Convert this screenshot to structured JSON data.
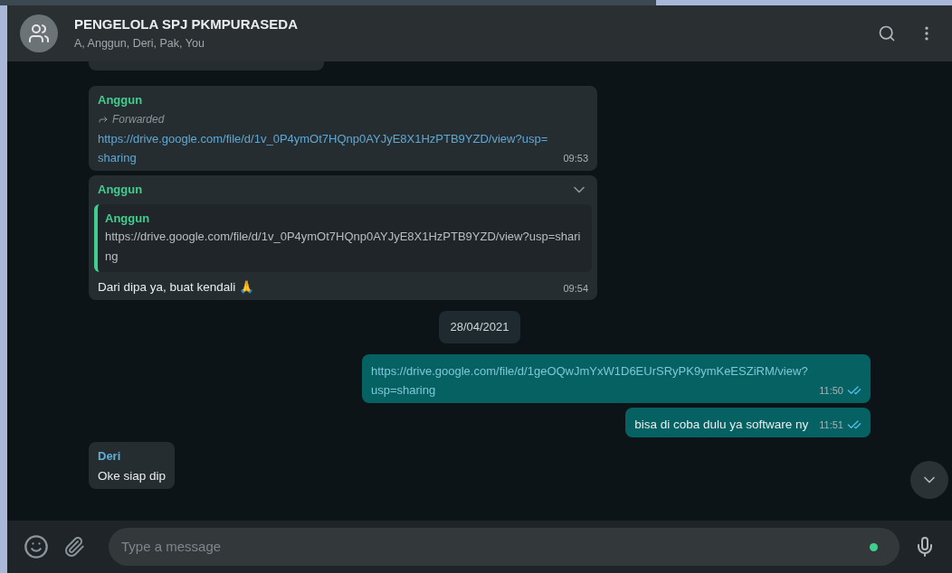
{
  "header": {
    "title": "PENGELOLA SPJ PKMPURASEDA",
    "participants": "A, Anggun, Deri, Pak, You"
  },
  "messages": [
    {
      "kind": "forwarded",
      "outgoing": false,
      "sender": "Anggun",
      "color": "#3fcf8e",
      "forwarded_label": "Forwarded",
      "text": "https://drive.google.com/file/d/1v_0P4ymOt7HQnp0AYJyE8X1HzPTB9YZD/view?usp=sharing",
      "link": true,
      "time": "09:53"
    },
    {
      "kind": "reply",
      "outgoing": false,
      "sender": "Anggun",
      "color": "#3fcf8e",
      "quote_sender": "Anggun",
      "quote_text": "https://drive.google.com/file/d/1v_0P4ymOt7HQnp0AYJyE8X1HzPTB9YZD/view?usp=sharing",
      "text": "Dari dipa ya, buat kendali 🙏",
      "link": false,
      "time": "09:54"
    },
    {
      "kind": "date",
      "text": "28/04/2021"
    },
    {
      "kind": "text",
      "outgoing": true,
      "text": "https://drive.google.com/file/d/1geOQwJmYxW1D6EUrSRyPK9ymKeESZiRM/view?usp=sharing",
      "link": true,
      "time": "11:50",
      "read": true
    },
    {
      "kind": "text",
      "outgoing": true,
      "text": "bisa di coba dulu ya software ny",
      "link": false,
      "time": "11:51",
      "read": true
    },
    {
      "kind": "text",
      "outgoing": false,
      "sender": "Deri",
      "color": "#5fb0d8",
      "text": "Oke siap dip",
      "link": false
    }
  ],
  "composer": {
    "placeholder": "Type a message"
  }
}
